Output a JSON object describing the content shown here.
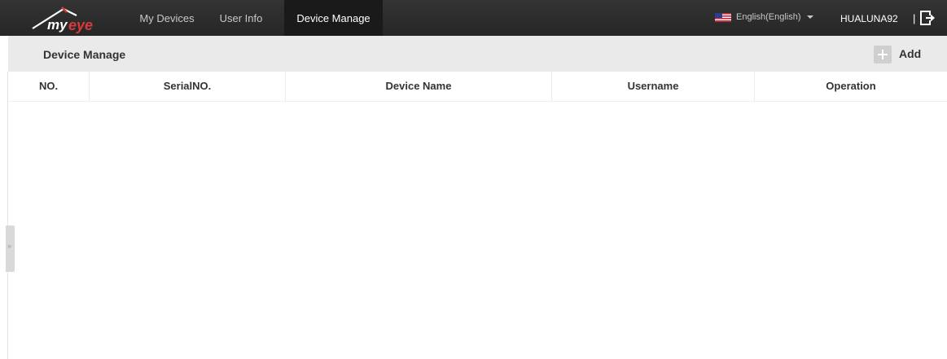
{
  "topbar": {
    "brand": "myeye",
    "nav": [
      {
        "label": "My Devices"
      },
      {
        "label": "User Info"
      },
      {
        "label": "Device Manage"
      }
    ],
    "language": "English(English)",
    "username": "HUALUNA92",
    "separator": "|"
  },
  "page": {
    "title": "Device Manage",
    "add_label": "Add"
  },
  "table": {
    "columns": [
      "NO.",
      "SerialNO.",
      "Device Name",
      "Username",
      "Operation"
    ],
    "rows": []
  },
  "side_handle": {
    "glyph": "»"
  },
  "colors": {
    "topbar_bg": "#2b2b2b",
    "active_nav_bg": "#1a1a1a",
    "header_bg": "#eaeaea",
    "logo_accent": "#d93a3a"
  }
}
